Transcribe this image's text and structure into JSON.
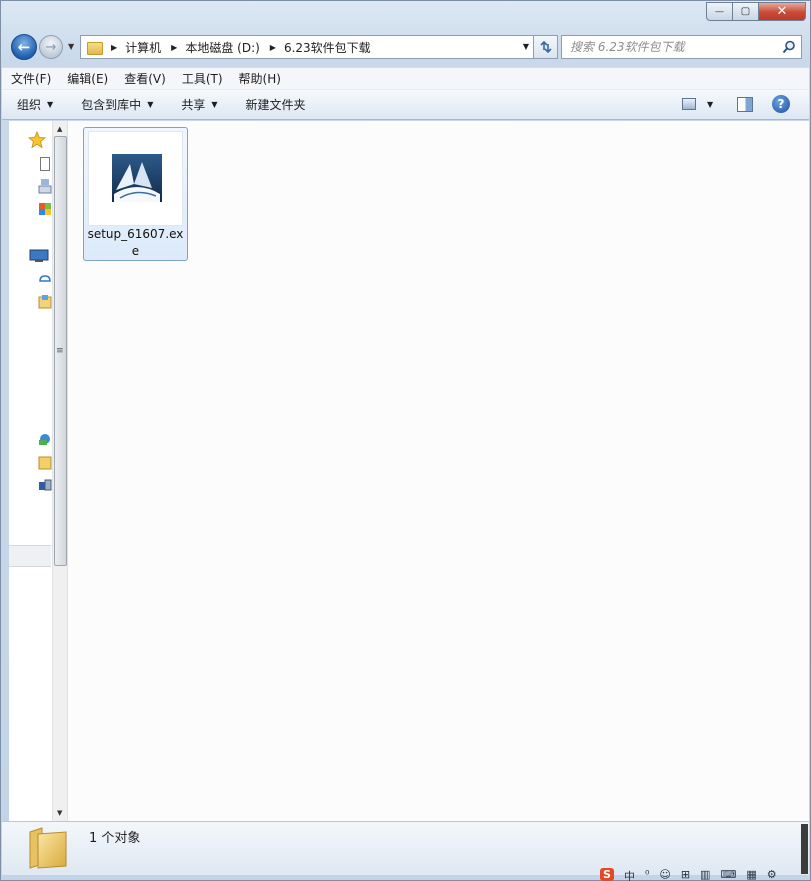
{
  "window": {
    "caption": {
      "minimize": "—",
      "maximize": "▢",
      "close": "✕"
    }
  },
  "nav": {
    "back_glyph": "←",
    "forward_glyph": "→",
    "breadcrumbs": [
      "计算机",
      "本地磁盘 (D:)",
      "6.23软件包下载"
    ],
    "search_placeholder": "搜索 6.23软件包下载"
  },
  "menubar": {
    "items": [
      "文件(F)",
      "编辑(E)",
      "查看(V)",
      "工具(T)",
      "帮助(H)"
    ]
  },
  "commandbar": {
    "organize": "组织",
    "include_in_library": "包含到库中",
    "share": "共享",
    "new_folder": "新建文件夹",
    "help": "?"
  },
  "files": [
    {
      "name": "setup_61607.exe",
      "type": "exe"
    }
  ],
  "details": {
    "status": "1 个对象"
  },
  "tray": {
    "items": [
      "S",
      "中",
      "⁰",
      "☺",
      "⊞",
      "▥",
      "⌨",
      "▦",
      "⚙"
    ]
  },
  "colors": {
    "accent": "#1f5fae",
    "selection": "#dceaf9",
    "close_button": "#c74b35"
  }
}
